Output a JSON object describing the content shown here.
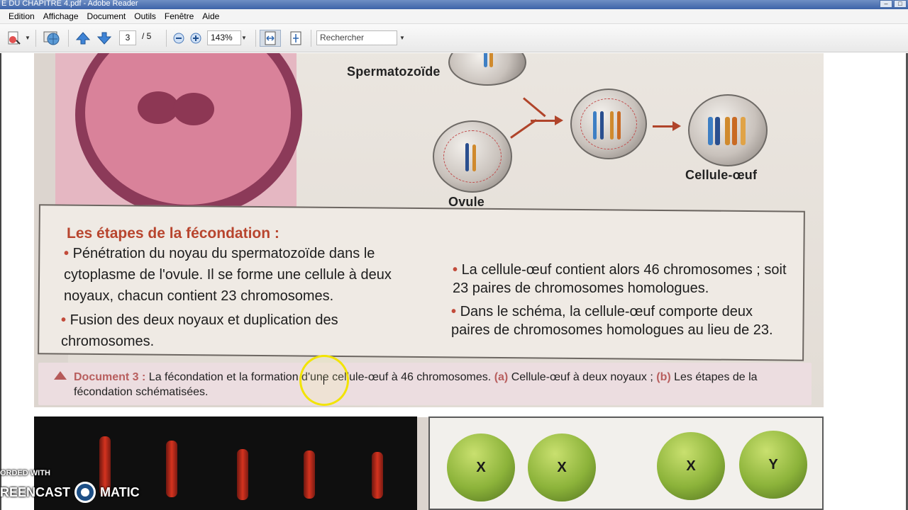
{
  "window": {
    "title": "E DU CHAPITRE 4.pdf - Adobe Reader"
  },
  "menu": {
    "items": [
      "Edition",
      "Affichage",
      "Document",
      "Outils",
      "Fenêtre",
      "Aide"
    ]
  },
  "toolbar": {
    "page_current": "3",
    "page_total": "/ 5",
    "zoom": "143%",
    "search_placeholder": "Rechercher"
  },
  "document": {
    "labels": {
      "sperm": "Spermatozoïde",
      "ovule": "Ovule",
      "zygote": "Cellule-œuf"
    },
    "steps_title": "Les étapes de la fécondation :",
    "left_col": {
      "p1": "Pénétration du noyau du spermatozoïde dans le cytoplasme de l'ovule. Il se forme une cellule à deux noyaux, chacun contient 23 chromosomes.",
      "p2": "Fusion des deux noyaux et duplication des chromosomes."
    },
    "right_col": {
      "p1": "La cellule-œuf contient alors 46 chromosomes ; soit 23 paires de chromosomes homologues.",
      "p2": "Dans le schéma, la cellule-œuf comporte deux paires de chromosomes homologues au lieu de 23."
    },
    "caption": {
      "doc": "Document 3 :",
      "text1": "La fécondation et la formation d'une cellule-œuf à 46 chromosomes.",
      "a": "(a)",
      "text2": "Cellule-œuf à deux noyaux ;",
      "b": "(b)",
      "text3": "Les étapes de la fécondation schématisées."
    },
    "ball_labels": [
      "X",
      "X",
      "X",
      "Y"
    ]
  },
  "watermark": {
    "line1": "ORDED WITH",
    "line2a": "REENCAST",
    "line2b": "MATIC"
  }
}
